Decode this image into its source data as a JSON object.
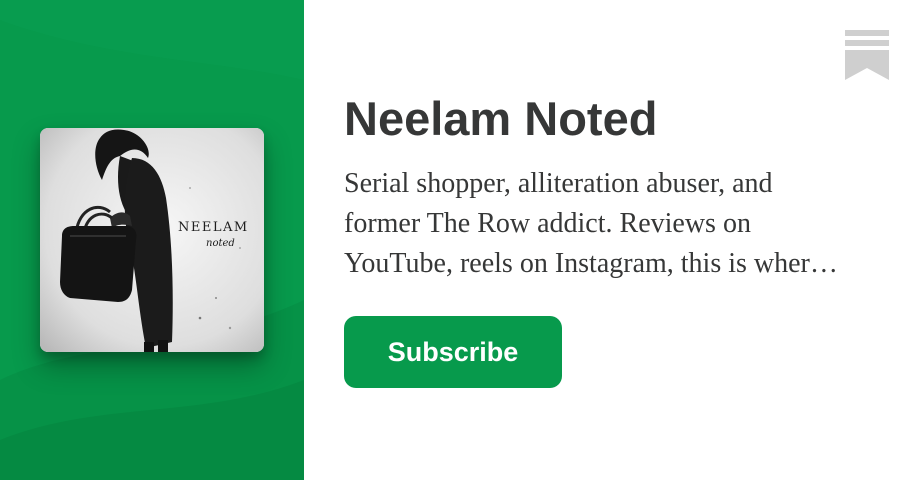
{
  "publication": {
    "title": "Neelam Noted",
    "description_lines": [
      "Serial shopper, alliteration abuser, and",
      "former The Row addict. Reviews on",
      "YouTube, reels on Instagram, this is wher…"
    ]
  },
  "cover": {
    "alt": "Neelam Noted cover art",
    "text_main": "NEELAM",
    "text_sub": "noted"
  },
  "actions": {
    "subscribe_label": "Subscribe"
  },
  "icons": {
    "bookmark": "bookmark-icon"
  },
  "colors": {
    "accent": "#079a4c",
    "text": "#363737",
    "icon": "#cfcfcf"
  }
}
